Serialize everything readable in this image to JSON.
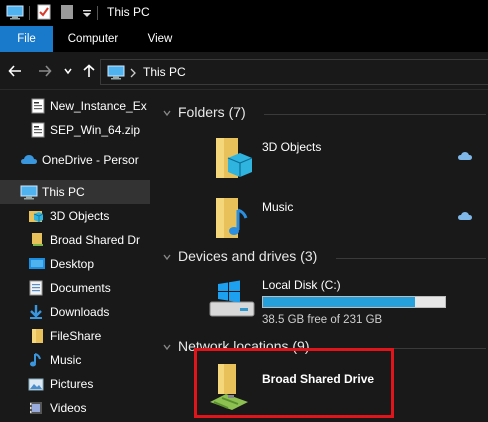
{
  "window": {
    "title": "This PC"
  },
  "ribbon": {
    "tabs": [
      {
        "label": "File"
      },
      {
        "label": "Computer"
      },
      {
        "label": "View"
      }
    ]
  },
  "address": {
    "path": "This PC"
  },
  "nav_pane": {
    "items": [
      {
        "label": "New_Instance_Ex",
        "icon": "text-document-icon"
      },
      {
        "label": "SEP_Win_64.zip",
        "icon": "zip-file-icon"
      },
      {
        "label": "OneDrive - Persor",
        "icon": "onedrive-cloud-icon"
      },
      {
        "label": "This PC",
        "icon": "this-pc-icon",
        "selected": true
      },
      {
        "label": "3D Objects",
        "icon": "3d-objects-folder-icon"
      },
      {
        "label": "Broad Shared Dr",
        "icon": "network-drive-icon"
      },
      {
        "label": "Desktop",
        "icon": "desktop-folder-icon"
      },
      {
        "label": "Documents",
        "icon": "documents-folder-icon"
      },
      {
        "label": "Downloads",
        "icon": "downloads-folder-icon"
      },
      {
        "label": "FileShare",
        "icon": "folder-icon"
      },
      {
        "label": "Music",
        "icon": "music-folder-icon"
      },
      {
        "label": "Pictures",
        "icon": "pictures-folder-icon"
      },
      {
        "label": "Videos",
        "icon": "videos-folder-icon"
      }
    ]
  },
  "main": {
    "folders": {
      "header": "Folders (7)",
      "items": [
        {
          "label": "3D Objects"
        },
        {
          "label": "Music"
        }
      ]
    },
    "devices": {
      "header": "Devices and drives (3)",
      "drive": {
        "label": "Local Disk (C:)",
        "free_text": "38.5 GB free of 231 GB",
        "used_fraction": 0.833
      }
    },
    "network": {
      "header": "Network locations (9)",
      "item": {
        "label": "Broad Shared Drive"
      }
    }
  },
  "colors": {
    "accent": "#1979ca",
    "drive_bar": "#26a0da",
    "highlight": "#e0151b",
    "background": "#191919"
  }
}
